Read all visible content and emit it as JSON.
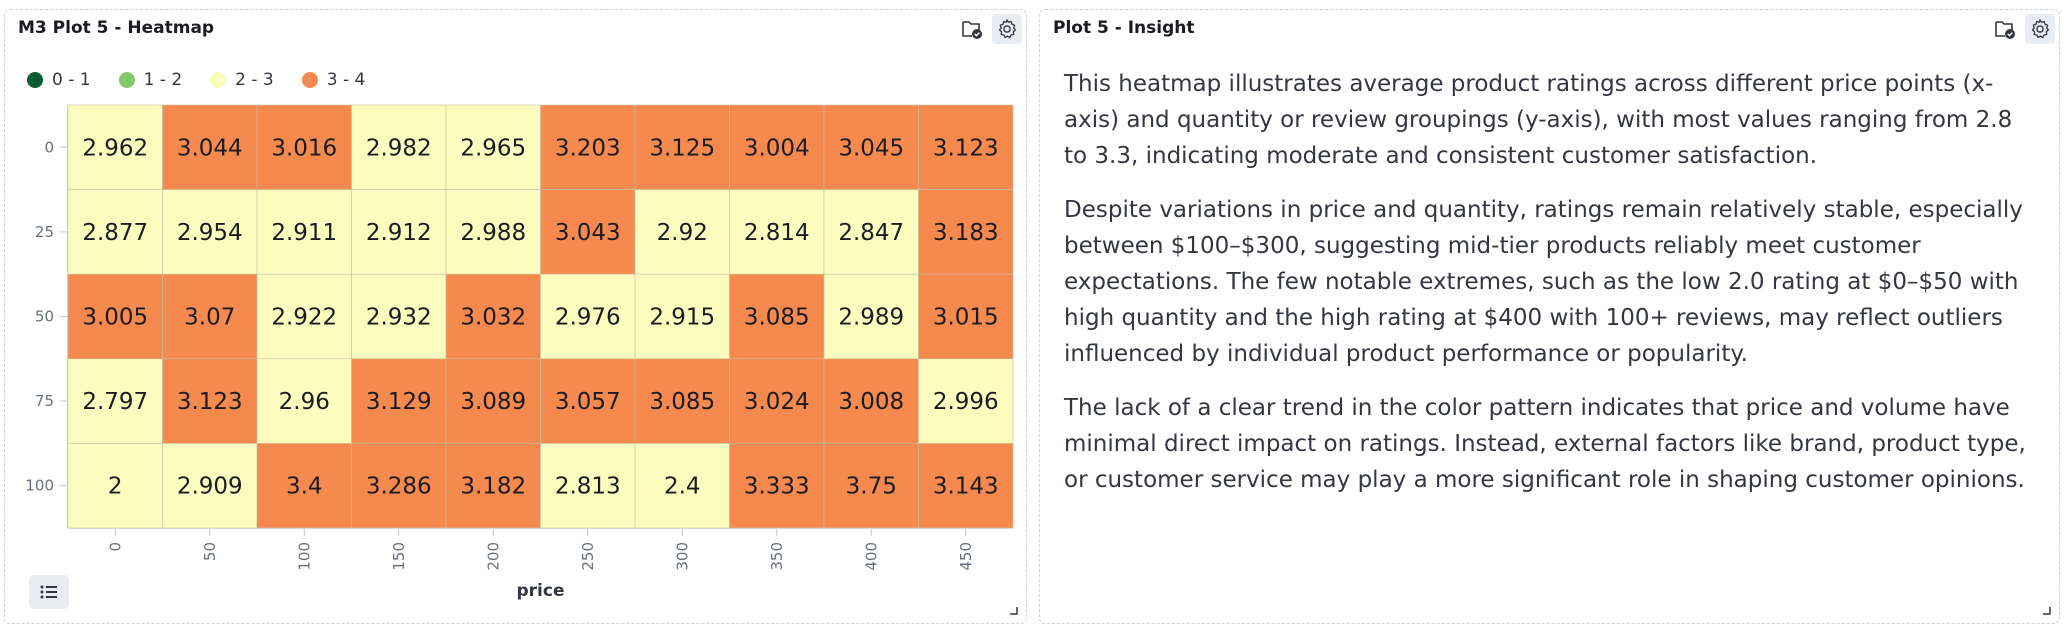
{
  "left_panel": {
    "title": "M3 Plot 5 - Heatmap"
  },
  "right_panel": {
    "title": "Plot 5 - Insight",
    "paragraphs": [
      "This heatmap illustrates average product ratings across different price points (x-axis) and quantity or review groupings (y-axis), with most values ranging from 2.8 to 3.3, indicating moderate and consistent customer satisfaction.",
      "Despite variations in price and quantity, ratings remain relatively stable, especially between $100–$300, suggesting mid-tier products reliably meet customer expectations. The few notable extremes, such as the low 2.0 rating at $0–$50 with high quantity and the high rating at $400 with 100+ reviews, may reflect outliers influenced by individual product performance or popularity.",
      "The lack of a clear trend in the color pattern indicates that price and volume have minimal direct impact on ratings. Instead, external factors like brand, product type, or customer service may play a more significant role in shaping customer opinions."
    ]
  },
  "chart_data": {
    "type": "heatmap",
    "xlabel": "price",
    "ylabel": "",
    "x": [
      "0",
      "50",
      "100",
      "150",
      "200",
      "250",
      "300",
      "350",
      "400",
      "450"
    ],
    "y": [
      "0",
      "25",
      "50",
      "75",
      "100"
    ],
    "values": [
      [
        2.962,
        3.044,
        3.016,
        2.982,
        2.965,
        3.203,
        3.125,
        3.004,
        3.045,
        3.123
      ],
      [
        2.877,
        2.954,
        2.911,
        2.912,
        2.988,
        3.043,
        2.92,
        2.814,
        2.847,
        3.183
      ],
      [
        3.005,
        3.07,
        2.922,
        2.932,
        3.032,
        2.976,
        2.915,
        3.085,
        2.989,
        3.015
      ],
      [
        2.797,
        3.123,
        2.96,
        3.129,
        3.089,
        3.057,
        3.085,
        3.024,
        3.008,
        2.996
      ],
      [
        2,
        2.909,
        3.4,
        3.286,
        3.182,
        2.813,
        2.4,
        3.333,
        3.75,
        3.143
      ]
    ],
    "legend": [
      {
        "label": "0 - 1",
        "min": 0,
        "max": 1,
        "color": "#0b5e34"
      },
      {
        "label": "1 - 2",
        "min": 1,
        "max": 2,
        "color": "#84c86a"
      },
      {
        "label": "2 - 3",
        "min": 2,
        "max": 3,
        "color": "#fdfcbf"
      },
      {
        "label": "3 - 4",
        "min": 3,
        "max": 4,
        "color": "#f68a4e"
      }
    ],
    "legend_position": "top-left"
  }
}
